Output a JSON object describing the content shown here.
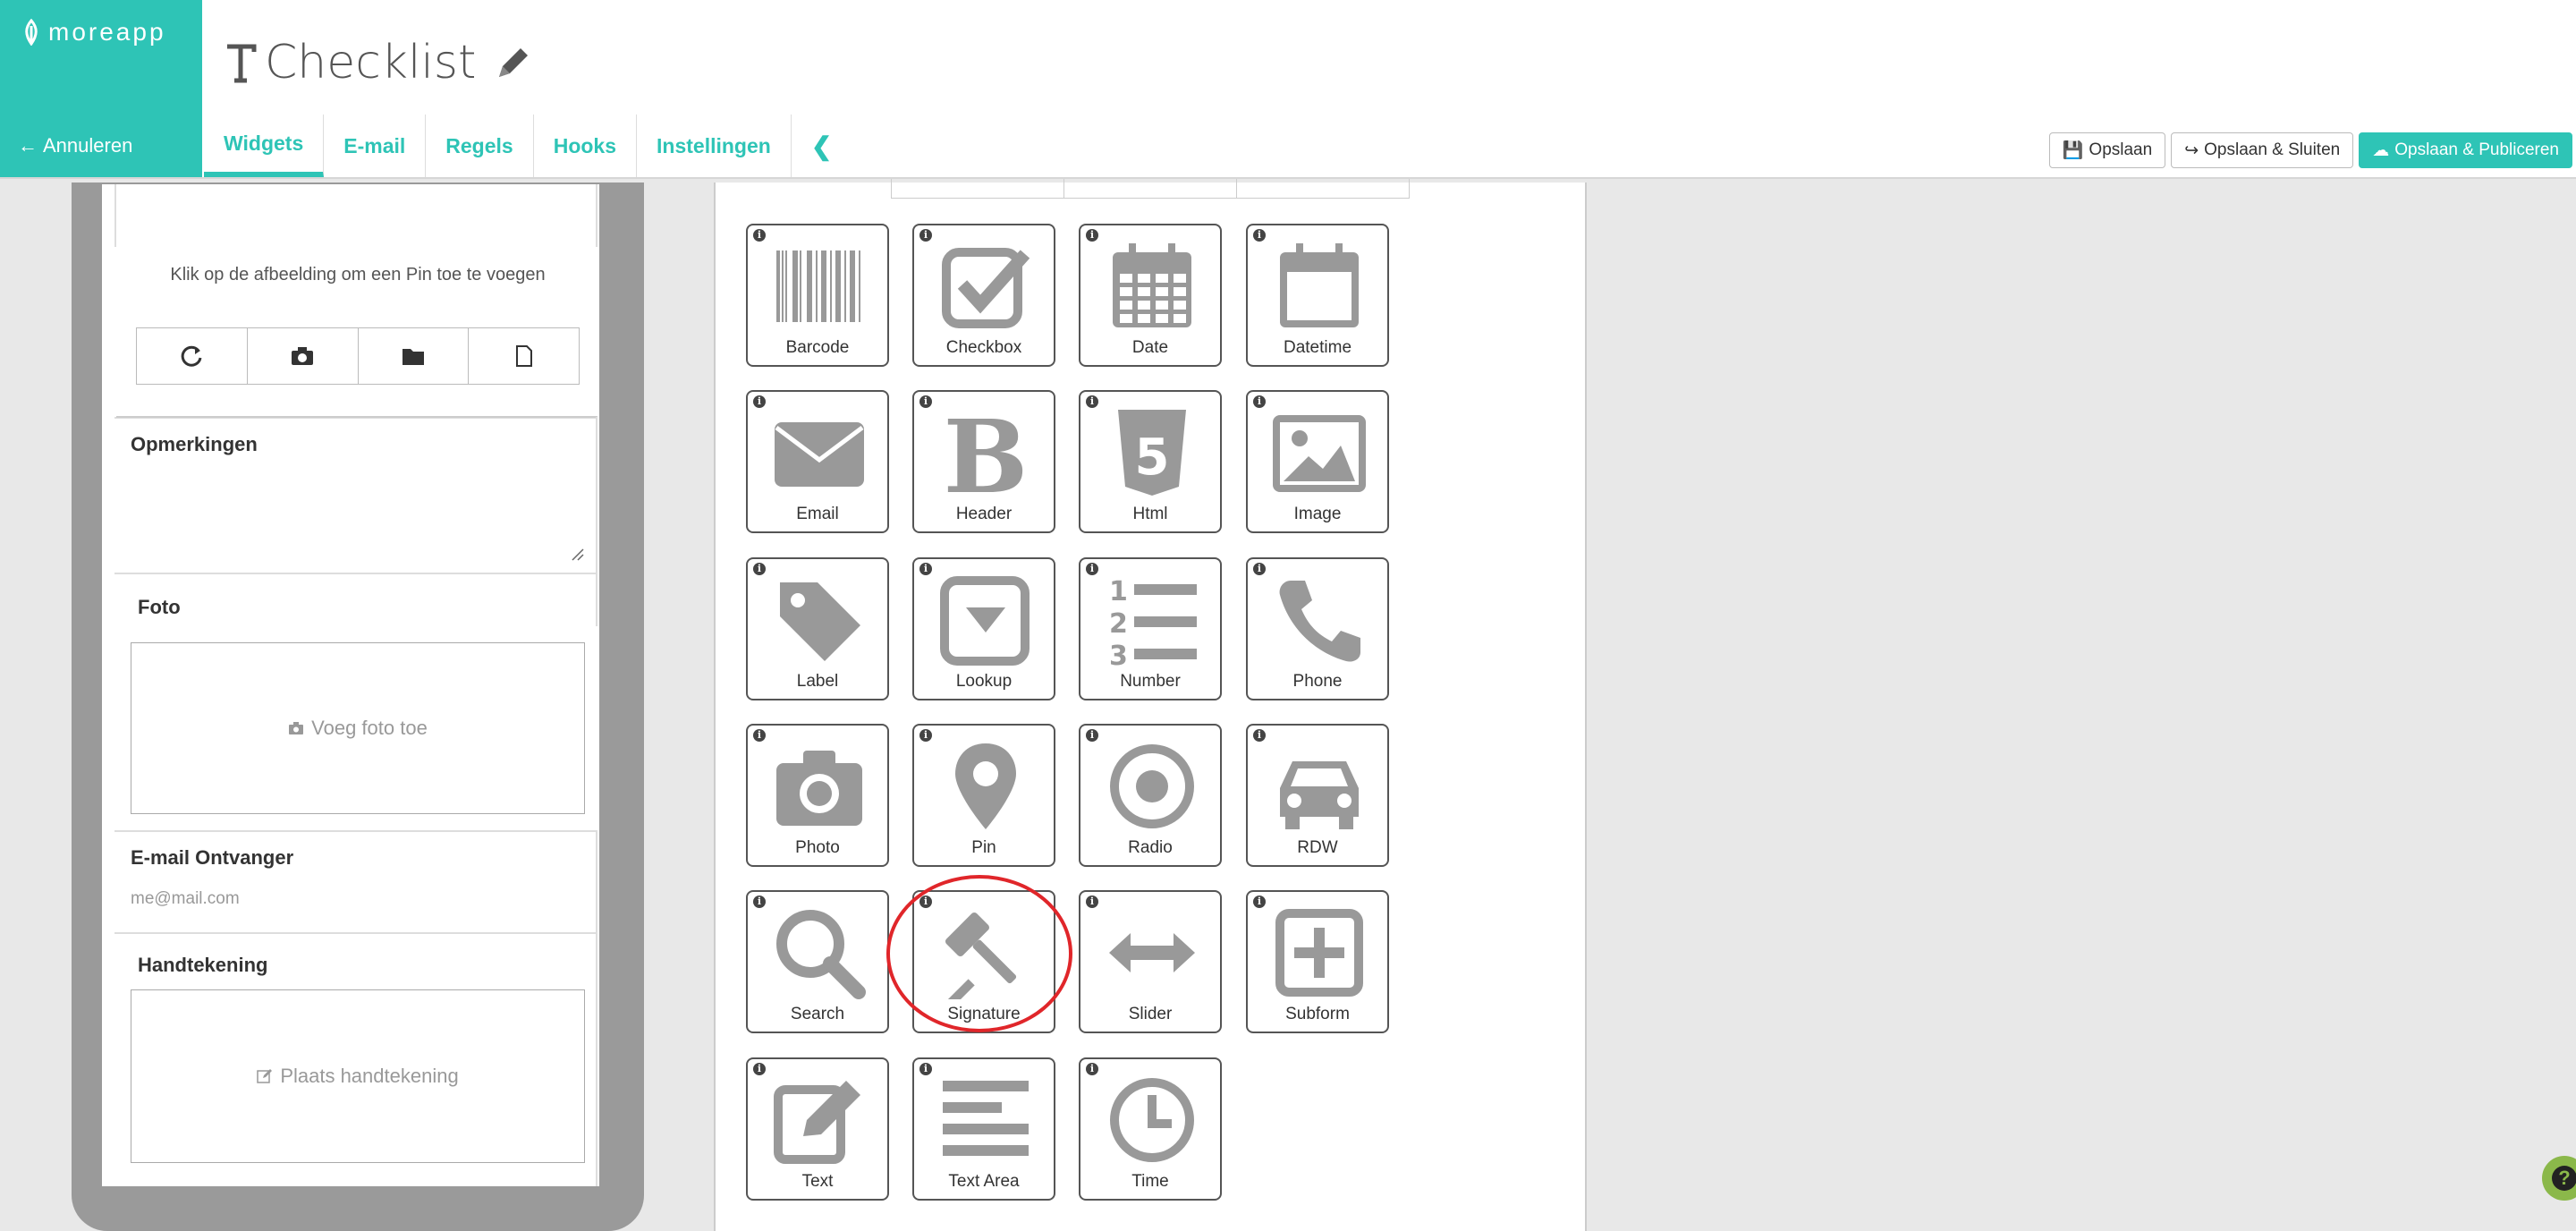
{
  "app": {
    "logo": "moreapp",
    "cancel_label": "Annuleren",
    "title": "Checklist",
    "accent_color": "#2ec4b6"
  },
  "tabs": [
    {
      "label": "Widgets",
      "active": true
    },
    {
      "label": "E-mail"
    },
    {
      "label": "Regels"
    },
    {
      "label": "Hooks"
    },
    {
      "label": "Instellingen"
    }
  ],
  "actions": {
    "save": "Opslaan",
    "save_close": "Opslaan & Sluiten",
    "save_publish": "Opslaan & Publiceren"
  },
  "preview": {
    "pin_hint": "Klik op de afbeelding om een Pin toe te voegen",
    "pin_tools": [
      "refresh-icon",
      "camera-icon",
      "folder-icon",
      "file-icon"
    ],
    "remarks_label": "Opmerkingen",
    "photo_label": "Foto",
    "photo_placeholder": "Voeg foto toe",
    "email_label": "E-mail Ontvanger",
    "email_placeholder": "me@mail.com",
    "signature_label": "Handtekening",
    "signature_placeholder": "Plaats handtekening"
  },
  "widgets": [
    {
      "label": "Barcode",
      "icon": "barcode-icon"
    },
    {
      "label": "Checkbox",
      "icon": "checkbox-icon"
    },
    {
      "label": "Date",
      "icon": "calendar-icon"
    },
    {
      "label": "Datetime",
      "icon": "calendar-blank-icon"
    },
    {
      "label": "Email",
      "icon": "envelope-icon"
    },
    {
      "label": "Header",
      "icon": "bold-icon"
    },
    {
      "label": "Html",
      "icon": "html5-icon"
    },
    {
      "label": "Image",
      "icon": "picture-icon"
    },
    {
      "label": "Label",
      "icon": "tag-icon"
    },
    {
      "label": "Lookup",
      "icon": "dropdown-icon"
    },
    {
      "label": "Number",
      "icon": "ordered-list-icon"
    },
    {
      "label": "Phone",
      "icon": "phone-icon"
    },
    {
      "label": "Photo",
      "icon": "camera-icon"
    },
    {
      "label": "Pin",
      "icon": "map-marker-icon"
    },
    {
      "label": "Radio",
      "icon": "radio-icon"
    },
    {
      "label": "RDW",
      "icon": "car-icon"
    },
    {
      "label": "Search",
      "icon": "search-icon"
    },
    {
      "label": "Signature",
      "icon": "gavel-icon"
    },
    {
      "label": "Slider",
      "icon": "arrows-horizontal-icon"
    },
    {
      "label": "Subform",
      "icon": "plus-square-icon"
    },
    {
      "label": "Text",
      "icon": "edit-icon"
    },
    {
      "label": "Text Area",
      "icon": "align-left-icon"
    },
    {
      "label": "Time",
      "icon": "clock-icon"
    }
  ],
  "help_label": "?"
}
